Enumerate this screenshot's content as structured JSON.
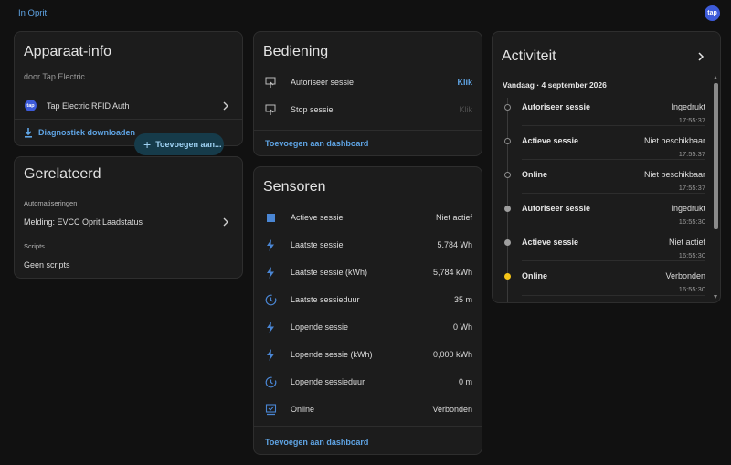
{
  "topbar": {
    "breadcrumb": "In Oprit",
    "logo_text": "tap"
  },
  "device_info": {
    "title": "Apparaat-info",
    "manufacturer": "door Tap Electric",
    "integration_logo": "tap",
    "integration_name": "Tap Electric RFID Auth",
    "download_label": "Diagnostiek downloaden"
  },
  "related": {
    "title": "Gerelateerd",
    "add_label": "Toevoegen aan...",
    "automations_header": "Automatiseringen",
    "automation_item": "Melding: EVCC Oprit Laadstatus",
    "scripts_header": "Scripts",
    "scripts_empty": "Geen scripts"
  },
  "controls": {
    "title": "Bediening",
    "items": [
      {
        "label": "Autoriseer sessie",
        "action": "Klik",
        "icon": "touch-icon",
        "enabled": true
      },
      {
        "label": "Stop sessie",
        "action": "Klik",
        "icon": "touch-icon",
        "enabled": false
      }
    ],
    "add_dashboard": "Toevoegen aan dashboard"
  },
  "sensors": {
    "title": "Sensoren",
    "items": [
      {
        "label": "Actieve sessie",
        "value": "Niet actief",
        "icon": "square-icon"
      },
      {
        "label": "Laatste sessie",
        "value": "5.784 Wh",
        "icon": "lightning-icon"
      },
      {
        "label": "Laatste sessie (kWh)",
        "value": "5,784 kWh",
        "icon": "lightning-icon"
      },
      {
        "label": "Laatste sessieduur",
        "value": "35 m",
        "icon": "timer-icon"
      },
      {
        "label": "Lopende sessie",
        "value": "0 Wh",
        "icon": "lightning-icon"
      },
      {
        "label": "Lopende sessie (kWh)",
        "value": "0,000 kWh",
        "icon": "lightning-icon"
      },
      {
        "label": "Lopende sessieduur",
        "value": "0 m",
        "icon": "timer-icon"
      },
      {
        "label": "Online",
        "value": "Verbonden",
        "icon": "monitor-check-icon"
      }
    ],
    "add_dashboard": "Toevoegen aan dashboard"
  },
  "activity": {
    "title": "Activiteit",
    "date_header": "Vandaag · 4 september 2026",
    "items": [
      {
        "label": "Autoriseer sessie",
        "value": "Ingedrukt",
        "time": "17:55:37",
        "dot": "hollow"
      },
      {
        "label": "Actieve sessie",
        "value": "Niet beschikbaar",
        "time": "17:55:37",
        "dot": "hollow"
      },
      {
        "label": "Online",
        "value": "Niet beschikbaar",
        "time": "17:55:37",
        "dot": "hollow"
      },
      {
        "label": "Autoriseer sessie",
        "value": "Ingedrukt",
        "time": "16:55:30",
        "dot": "grey"
      },
      {
        "label": "Actieve sessie",
        "value": "Niet actief",
        "time": "16:55:30",
        "dot": "grey"
      },
      {
        "label": "Online",
        "value": "Verbonden",
        "time": "16:55:30",
        "dot": "yellow"
      }
    ]
  },
  "colors": {
    "accent": "#5fa4e4",
    "icon_blue": "#4a86d4",
    "active_dot": "#f5c518"
  }
}
